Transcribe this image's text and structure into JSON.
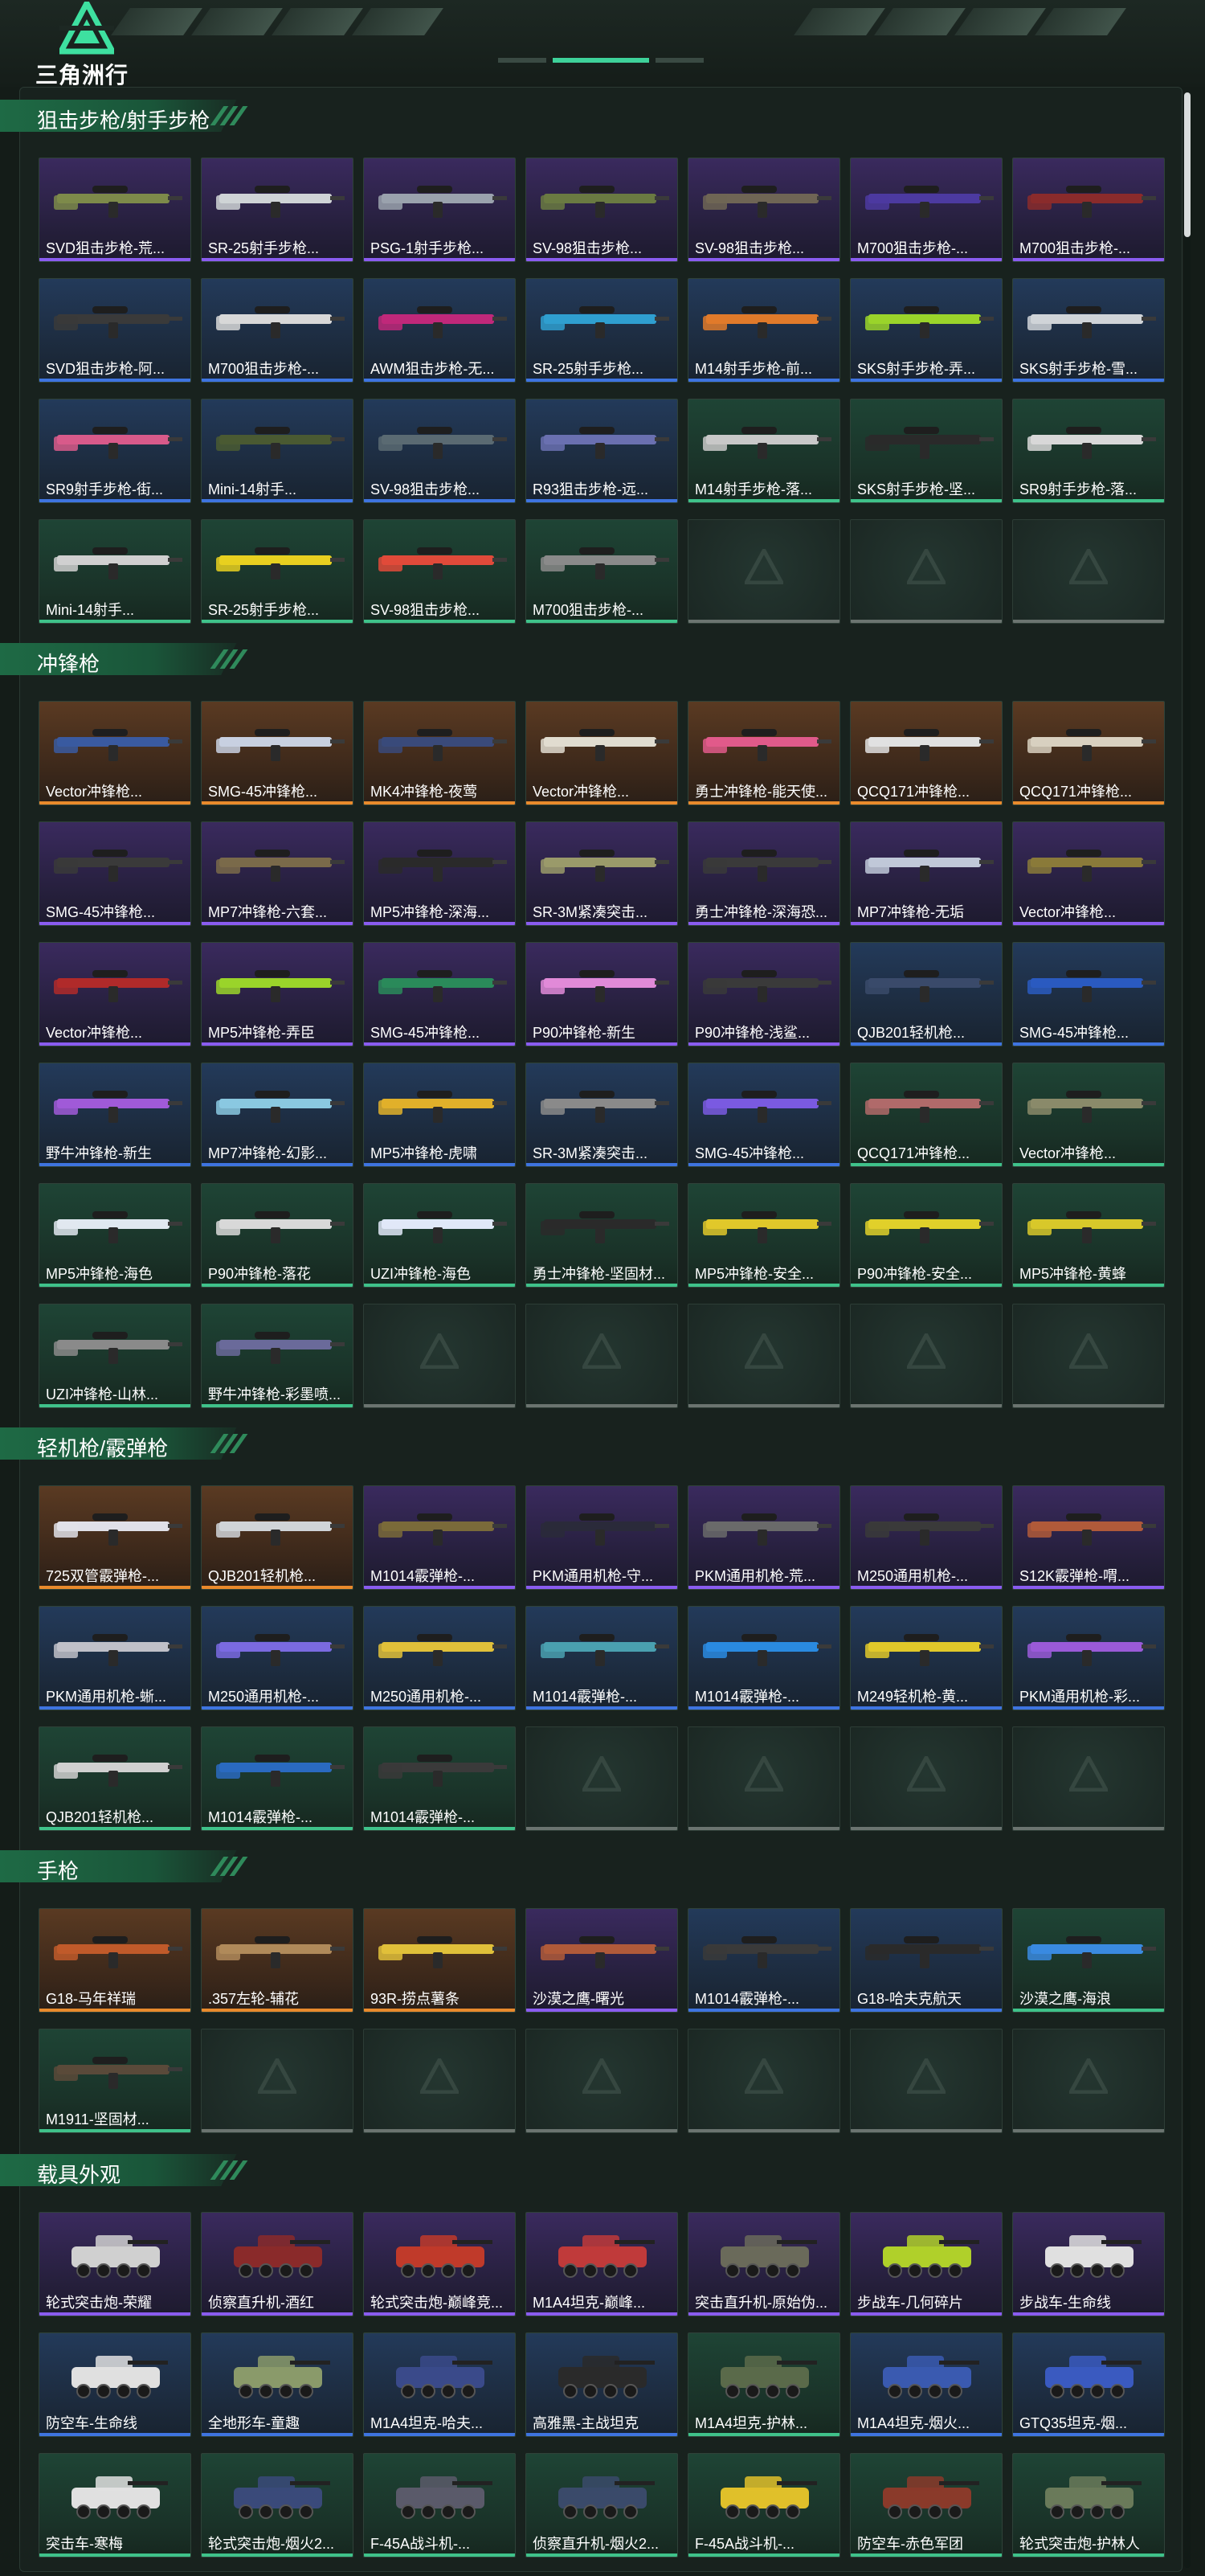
{
  "app": {
    "logo_text": "三角洲行动"
  },
  "sections": [
    {
      "title": "狙击步枪/射手步枪",
      "items": [
        {
          "label": "SVD狙击步枪-荒...",
          "rarity": "purple",
          "color": "#7d8a4a"
        },
        {
          "label": "SR-25射手步枪...",
          "rarity": "purple",
          "color": "#cfd3d6"
        },
        {
          "label": "PSG-1射手步枪...",
          "rarity": "purple",
          "color": "#9aa2ad"
        },
        {
          "label": "SV-98狙击步枪...",
          "rarity": "purple",
          "color": "#6a7a42"
        },
        {
          "label": "SV-98狙击步枪...",
          "rarity": "purple",
          "color": "#6f6555"
        },
        {
          "label": "M700狙击步枪-...",
          "rarity": "purple",
          "color": "#4c3aa0"
        },
        {
          "label": "M700狙击步枪-...",
          "rarity": "purple",
          "color": "#8a2b2b"
        },
        {
          "label": "SVD狙击步枪-阿...",
          "rarity": "blue",
          "color": "#3a3a3a"
        },
        {
          "label": "M700狙击步枪-...",
          "rarity": "blue",
          "color": "#d8d8d8"
        },
        {
          "label": "AWM狙击步枪-无...",
          "rarity": "blue",
          "color": "#c0287a"
        },
        {
          "label": "SR-25射手步枪...",
          "rarity": "blue",
          "color": "#2f9fd0"
        },
        {
          "label": "M14射手步枪-前...",
          "rarity": "blue",
          "color": "#e07a2a"
        },
        {
          "label": "SKS射手步枪-弄...",
          "rarity": "blue",
          "color": "#9ad42a"
        },
        {
          "label": "SKS射手步枪-雪...",
          "rarity": "blue",
          "color": "#d0d4d8"
        },
        {
          "label": "SR9射手步枪-街...",
          "rarity": "blue",
          "color": "#d85a8a"
        },
        {
          "label": "Mini-14射手...",
          "rarity": "blue",
          "color": "#4a5a32"
        },
        {
          "label": "SV-98狙击步枪...",
          "rarity": "blue",
          "color": "#5a6a72"
        },
        {
          "label": "R93狙击步枪-远...",
          "rarity": "blue",
          "color": "#6a70b0"
        },
        {
          "label": "M14射手步枪-落...",
          "rarity": "green",
          "color": "#c8c8c8"
        },
        {
          "label": "SKS射手步枪-坚...",
          "rarity": "green",
          "color": "#2a2a2a"
        },
        {
          "label": "SR9射手步枪-落...",
          "rarity": "green",
          "color": "#d8d8d8"
        },
        {
          "label": "Mini-14射手...",
          "rarity": "green",
          "color": "#d0d0d0"
        },
        {
          "label": "SR-25射手步枪...",
          "rarity": "green",
          "color": "#e8d020"
        },
        {
          "label": "SV-98狙击步枪...",
          "rarity": "green",
          "color": "#e04a3a"
        },
        {
          "label": "M700狙击步枪-...",
          "rarity": "green",
          "color": "#8a8a8a"
        }
      ]
    },
    {
      "title": "冲锋枪",
      "items": [
        {
          "label": "Vector冲锋枪...",
          "rarity": "orange",
          "color": "#3a5aa0"
        },
        {
          "label": "SMG-45冲锋枪...",
          "rarity": "orange",
          "color": "#c8d0e0"
        },
        {
          "label": "MK4冲锋枪-夜莺",
          "rarity": "orange",
          "color": "#3a4a7a"
        },
        {
          "label": "Vector冲锋枪...",
          "rarity": "orange",
          "color": "#e0dcd0"
        },
        {
          "label": "勇士冲锋枪-能天使...",
          "rarity": "orange",
          "color": "#e05a8a"
        },
        {
          "label": "QCQ171冲锋枪...",
          "rarity": "orange",
          "color": "#e0e0e0"
        },
        {
          "label": "QCQ171冲锋枪...",
          "rarity": "orange",
          "color": "#d8d0c0"
        },
        {
          "label": "SMG-45冲锋枪...",
          "rarity": "purple",
          "color": "#3a3a3a"
        },
        {
          "label": "MP7冲锋枪-六套...",
          "rarity": "purple",
          "color": "#7a6a4a"
        },
        {
          "label": "MP5冲锋枪-深海...",
          "rarity": "purple",
          "color": "#2a2a2a"
        },
        {
          "label": "SR-3M紧凑突击...",
          "rarity": "purple",
          "color": "#9a9a6a"
        },
        {
          "label": "勇士冲锋枪-深海恐...",
          "rarity": "purple",
          "color": "#3a3a3a"
        },
        {
          "label": "MP7冲锋枪-无垢",
          "rarity": "purple",
          "color": "#c0c8d8"
        },
        {
          "label": "Vector冲锋枪...",
          "rarity": "purple",
          "color": "#8a7a3a"
        },
        {
          "label": "Vector冲锋枪...",
          "rarity": "purple",
          "color": "#b02a2a"
        },
        {
          "label": "MP5冲锋枪-弄臣",
          "rarity": "purple",
          "color": "#9ad42a"
        },
        {
          "label": "SMG-45冲锋枪...",
          "rarity": "purple",
          "color": "#2a8a5a"
        },
        {
          "label": "P90冲锋枪-新生",
          "rarity": "purple",
          "color": "#e08ad8"
        },
        {
          "label": "P90冲锋枪-浅鲨...",
          "rarity": "purple",
          "color": "#3a3a3a"
        },
        {
          "label": "QJB201轻机枪...",
          "rarity": "blue",
          "color": "#3a4a6a"
        },
        {
          "label": "SMG-45冲锋枪...",
          "rarity": "blue",
          "color": "#2a5ac0"
        },
        {
          "label": "野牛冲锋枪-新生",
          "rarity": "blue",
          "color": "#a05ad8"
        },
        {
          "label": "MP7冲锋枪-幻影...",
          "rarity": "blue",
          "color": "#8ac8e0"
        },
        {
          "label": "MP5冲锋枪-虎啸",
          "rarity": "blue",
          "color": "#e0b02a"
        },
        {
          "label": "SR-3M紧凑突击...",
          "rarity": "blue",
          "color": "#8a8a8a"
        },
        {
          "label": "SMG-45冲锋枪...",
          "rarity": "blue",
          "color": "#7a5ae0"
        },
        {
          "label": "QCQ171冲锋枪...",
          "rarity": "green",
          "color": "#b06a6a"
        },
        {
          "label": "Vector冲锋枪...",
          "rarity": "green",
          "color": "#8a8a6a"
        },
        {
          "label": "MP5冲锋枪-海色",
          "rarity": "green",
          "color": "#e0e8f0"
        },
        {
          "label": "P90冲锋枪-落花",
          "rarity": "green",
          "color": "#d8d8d8"
        },
        {
          "label": "UZI冲锋枪-海色",
          "rarity": "green",
          "color": "#e0e8f8"
        },
        {
          "label": "勇士冲锋枪-坚固材...",
          "rarity": "green",
          "color": "#2a2a2a"
        },
        {
          "label": "MP5冲锋枪-安全...",
          "rarity": "green",
          "color": "#e0c82a"
        },
        {
          "label": "P90冲锋枪-安全...",
          "rarity": "green",
          "color": "#e0d02a"
        },
        {
          "label": "MP5冲锋枪-黄蜂",
          "rarity": "green",
          "color": "#d8c82a"
        },
        {
          "label": "UZI冲锋枪-山林...",
          "rarity": "green",
          "color": "#8a8a8a"
        },
        {
          "label": "野牛冲锋枪-彩墨喷...",
          "rarity": "green",
          "color": "#6a6a9a"
        }
      ]
    },
    {
      "title": "轻机枪/霰弹枪",
      "items": [
        {
          "label": "725双管霰弹枪-...",
          "rarity": "orange",
          "color": "#e0e0e8"
        },
        {
          "label": "QJB201轻机枪...",
          "rarity": "orange",
          "color": "#d0d4d8"
        },
        {
          "label": "M1014霰弹枪-...",
          "rarity": "purple",
          "color": "#7a6a3a"
        },
        {
          "label": "PKM通用机枪-守...",
          "rarity": "purple",
          "color": "#2a2a3a"
        },
        {
          "label": "PKM通用机枪-荒...",
          "rarity": "purple",
          "color": "#6a6a6a"
        },
        {
          "label": "M250通用机枪-...",
          "rarity": "purple",
          "color": "#3a3a3a"
        },
        {
          "label": "S12K霰弹枪-喟...",
          "rarity": "purple",
          "color": "#b05a3a"
        },
        {
          "label": "PKM通用机枪-蜥...",
          "rarity": "blue",
          "color": "#c0c0c8"
        },
        {
          "label": "M250通用机枪-...",
          "rarity": "blue",
          "color": "#7a6ae0"
        },
        {
          "label": "M250通用机枪-...",
          "rarity": "blue",
          "color": "#e0c03a"
        },
        {
          "label": "M1014霰弹枪-...",
          "rarity": "blue",
          "color": "#4aa0b0"
        },
        {
          "label": "M1014霰弹枪-...",
          "rarity": "blue",
          "color": "#2a8ae0"
        },
        {
          "label": "M249轻机枪-黄...",
          "rarity": "blue",
          "color": "#e0c82a"
        },
        {
          "label": "PKM通用机枪-彩...",
          "rarity": "blue",
          "color": "#9a5ad8"
        },
        {
          "label": "QJB201轻机枪...",
          "rarity": "green",
          "color": "#d0d0d0"
        },
        {
          "label": "M1014霰弹枪-...",
          "rarity": "green",
          "color": "#2a6ac0"
        },
        {
          "label": "M1014霰弹枪-...",
          "rarity": "green",
          "color": "#3a3a3a"
        }
      ]
    },
    {
      "title": "手枪",
      "items": [
        {
          "label": "G18-马年祥瑞",
          "rarity": "orange",
          "color": "#c05a2a"
        },
        {
          "label": ".357左轮-辅花",
          "rarity": "orange",
          "color": "#b08a5a"
        },
        {
          "label": "93R-捞点薯条",
          "rarity": "orange",
          "color": "#e0c03a"
        },
        {
          "label": "沙漠之鹰-曙光",
          "rarity": "purple",
          "color": "#b05a3a"
        },
        {
          "label": "M1014霰弹枪-...",
          "rarity": "blue",
          "color": "#3a3a3a"
        },
        {
          "label": "G18-哈夫克航天",
          "rarity": "blue",
          "color": "#2a2a2a"
        },
        {
          "label": "沙漠之鹰-海浪",
          "rarity": "green",
          "color": "#3a8ae0"
        },
        {
          "label": "M1911-坚固材...",
          "rarity": "green",
          "color": "#5a4a3a"
        }
      ]
    },
    {
      "title": "载具外观",
      "items": [
        {
          "label": "轮式突击炮-荣耀",
          "rarity": "purple",
          "color": "#d0d0d0"
        },
        {
          "label": "侦察直升机-酒红",
          "rarity": "purple",
          "color": "#8a2a2a"
        },
        {
          "label": "轮式突击炮-巅峰竞...",
          "rarity": "purple",
          "color": "#c03a2a"
        },
        {
          "label": "M1A4坦克-巅峰...",
          "rarity": "purple",
          "color": "#c03a3a"
        },
        {
          "label": "突击直升机-原始伪...",
          "rarity": "purple",
          "color": "#6a6a5a"
        },
        {
          "label": "步战车-几何碎片",
          "rarity": "purple",
          "color": "#b0d02a"
        },
        {
          "label": "步战车-生命线",
          "rarity": "purple",
          "color": "#e0e0e0"
        },
        {
          "label": "防空车-生命线",
          "rarity": "blue",
          "color": "#e0e0e0"
        },
        {
          "label": "全地形车-童趣",
          "rarity": "blue",
          "color": "#8a9a6a"
        },
        {
          "label": "M1A4坦克-哈夫...",
          "rarity": "blue",
          "color": "#3a4a8a"
        },
        {
          "label": "高雅黑-主战坦克",
          "rarity": "blue",
          "color": "#2a2a2a"
        },
        {
          "label": "M1A4坦克-护林...",
          "rarity": "green",
          "color": "#5a6a4a"
        },
        {
          "label": "M1A4坦克-烟火...",
          "rarity": "blue",
          "color": "#3a5ab0"
        },
        {
          "label": "GTQ35坦克-烟...",
          "rarity": "blue",
          "color": "#3a5ac0"
        },
        {
          "label": "突击车-寒梅",
          "rarity": "green",
          "color": "#e0e0e0"
        },
        {
          "label": "轮式突击炮-烟火2...",
          "rarity": "green",
          "color": "#3a4a7a"
        },
        {
          "label": "F-45A战斗机-...",
          "rarity": "green",
          "color": "#5a5a6a"
        },
        {
          "label": "侦察直升机-烟火2...",
          "rarity": "green",
          "color": "#3a4a6a"
        },
        {
          "label": "F-45A战斗机-...",
          "rarity": "green",
          "color": "#e0c02a"
        },
        {
          "label": "防空车-赤色军团",
          "rarity": "green",
          "color": "#8a3a2a"
        },
        {
          "label": "轮式突击炮-护林人",
          "rarity": "green",
          "color": "#6a7a5a"
        }
      ]
    }
  ]
}
